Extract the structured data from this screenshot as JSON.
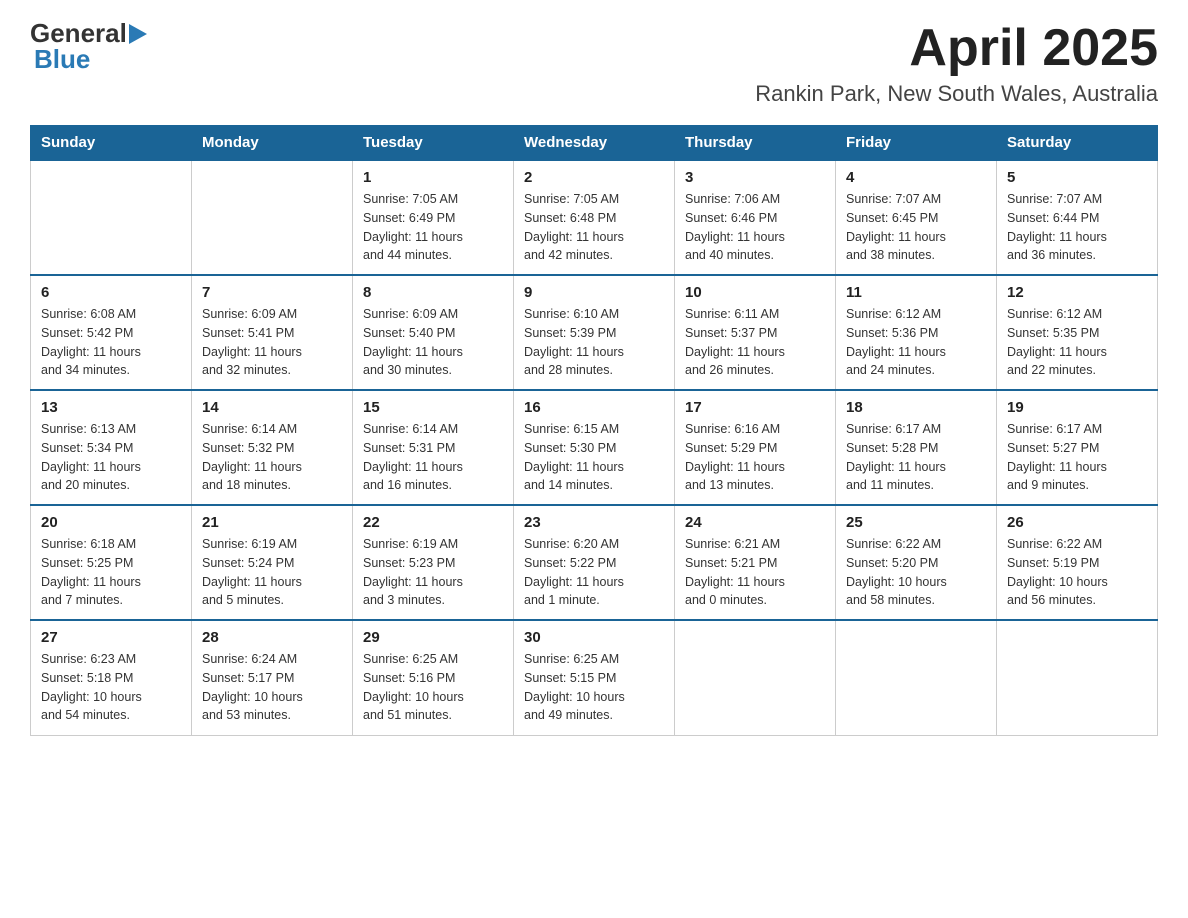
{
  "header": {
    "logo_general": "General",
    "logo_blue": "Blue",
    "title": "April 2025",
    "subtitle": "Rankin Park, New South Wales, Australia"
  },
  "days_of_week": [
    "Sunday",
    "Monday",
    "Tuesday",
    "Wednesday",
    "Thursday",
    "Friday",
    "Saturday"
  ],
  "weeks": [
    [
      {
        "day": "",
        "info": ""
      },
      {
        "day": "",
        "info": ""
      },
      {
        "day": "1",
        "info": "Sunrise: 7:05 AM\nSunset: 6:49 PM\nDaylight: 11 hours\nand 44 minutes."
      },
      {
        "day": "2",
        "info": "Sunrise: 7:05 AM\nSunset: 6:48 PM\nDaylight: 11 hours\nand 42 minutes."
      },
      {
        "day": "3",
        "info": "Sunrise: 7:06 AM\nSunset: 6:46 PM\nDaylight: 11 hours\nand 40 minutes."
      },
      {
        "day": "4",
        "info": "Sunrise: 7:07 AM\nSunset: 6:45 PM\nDaylight: 11 hours\nand 38 minutes."
      },
      {
        "day": "5",
        "info": "Sunrise: 7:07 AM\nSunset: 6:44 PM\nDaylight: 11 hours\nand 36 minutes."
      }
    ],
    [
      {
        "day": "6",
        "info": "Sunrise: 6:08 AM\nSunset: 5:42 PM\nDaylight: 11 hours\nand 34 minutes."
      },
      {
        "day": "7",
        "info": "Sunrise: 6:09 AM\nSunset: 5:41 PM\nDaylight: 11 hours\nand 32 minutes."
      },
      {
        "day": "8",
        "info": "Sunrise: 6:09 AM\nSunset: 5:40 PM\nDaylight: 11 hours\nand 30 minutes."
      },
      {
        "day": "9",
        "info": "Sunrise: 6:10 AM\nSunset: 5:39 PM\nDaylight: 11 hours\nand 28 minutes."
      },
      {
        "day": "10",
        "info": "Sunrise: 6:11 AM\nSunset: 5:37 PM\nDaylight: 11 hours\nand 26 minutes."
      },
      {
        "day": "11",
        "info": "Sunrise: 6:12 AM\nSunset: 5:36 PM\nDaylight: 11 hours\nand 24 minutes."
      },
      {
        "day": "12",
        "info": "Sunrise: 6:12 AM\nSunset: 5:35 PM\nDaylight: 11 hours\nand 22 minutes."
      }
    ],
    [
      {
        "day": "13",
        "info": "Sunrise: 6:13 AM\nSunset: 5:34 PM\nDaylight: 11 hours\nand 20 minutes."
      },
      {
        "day": "14",
        "info": "Sunrise: 6:14 AM\nSunset: 5:32 PM\nDaylight: 11 hours\nand 18 minutes."
      },
      {
        "day": "15",
        "info": "Sunrise: 6:14 AM\nSunset: 5:31 PM\nDaylight: 11 hours\nand 16 minutes."
      },
      {
        "day": "16",
        "info": "Sunrise: 6:15 AM\nSunset: 5:30 PM\nDaylight: 11 hours\nand 14 minutes."
      },
      {
        "day": "17",
        "info": "Sunrise: 6:16 AM\nSunset: 5:29 PM\nDaylight: 11 hours\nand 13 minutes."
      },
      {
        "day": "18",
        "info": "Sunrise: 6:17 AM\nSunset: 5:28 PM\nDaylight: 11 hours\nand 11 minutes."
      },
      {
        "day": "19",
        "info": "Sunrise: 6:17 AM\nSunset: 5:27 PM\nDaylight: 11 hours\nand 9 minutes."
      }
    ],
    [
      {
        "day": "20",
        "info": "Sunrise: 6:18 AM\nSunset: 5:25 PM\nDaylight: 11 hours\nand 7 minutes."
      },
      {
        "day": "21",
        "info": "Sunrise: 6:19 AM\nSunset: 5:24 PM\nDaylight: 11 hours\nand 5 minutes."
      },
      {
        "day": "22",
        "info": "Sunrise: 6:19 AM\nSunset: 5:23 PM\nDaylight: 11 hours\nand 3 minutes."
      },
      {
        "day": "23",
        "info": "Sunrise: 6:20 AM\nSunset: 5:22 PM\nDaylight: 11 hours\nand 1 minute."
      },
      {
        "day": "24",
        "info": "Sunrise: 6:21 AM\nSunset: 5:21 PM\nDaylight: 11 hours\nand 0 minutes."
      },
      {
        "day": "25",
        "info": "Sunrise: 6:22 AM\nSunset: 5:20 PM\nDaylight: 10 hours\nand 58 minutes."
      },
      {
        "day": "26",
        "info": "Sunrise: 6:22 AM\nSunset: 5:19 PM\nDaylight: 10 hours\nand 56 minutes."
      }
    ],
    [
      {
        "day": "27",
        "info": "Sunrise: 6:23 AM\nSunset: 5:18 PM\nDaylight: 10 hours\nand 54 minutes."
      },
      {
        "day": "28",
        "info": "Sunrise: 6:24 AM\nSunset: 5:17 PM\nDaylight: 10 hours\nand 53 minutes."
      },
      {
        "day": "29",
        "info": "Sunrise: 6:25 AM\nSunset: 5:16 PM\nDaylight: 10 hours\nand 51 minutes."
      },
      {
        "day": "30",
        "info": "Sunrise: 6:25 AM\nSunset: 5:15 PM\nDaylight: 10 hours\nand 49 minutes."
      },
      {
        "day": "",
        "info": ""
      },
      {
        "day": "",
        "info": ""
      },
      {
        "day": "",
        "info": ""
      }
    ]
  ]
}
